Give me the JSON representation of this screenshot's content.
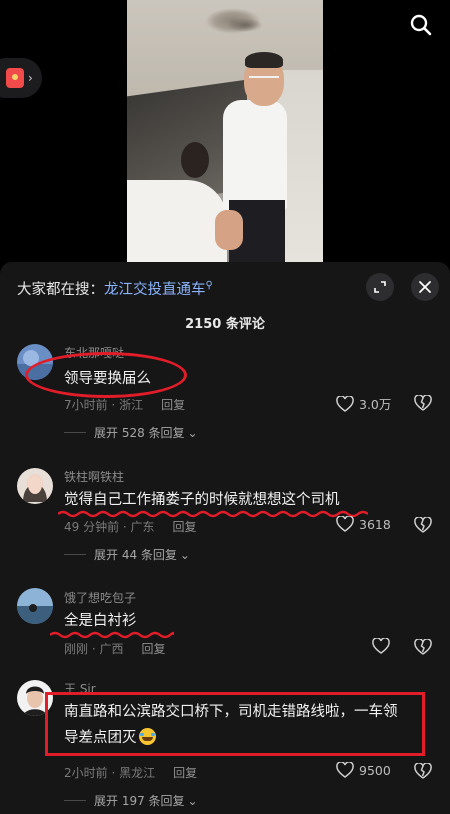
{
  "colors": {
    "panel_bg": "#161616",
    "annotation_red": "#e11d2a",
    "link_blue": "#8ab4ff"
  },
  "top": {
    "search_icon": "search-icon",
    "side_icon": "red-packet-icon"
  },
  "panel": {
    "hot_search_prefix": "大家都在搜：",
    "hot_search_term": "龙江交投直通车",
    "comment_count_title": "2150 条评论"
  },
  "comments": [
    {
      "username": "东北那嘎哒",
      "text": "领导要换届么",
      "time_location": "7小时前 · 浙江",
      "reply_label": "回复",
      "likes": "3.0万",
      "expand_label": "展开 528 条回复"
    },
    {
      "username": "铁柱啊铁柱",
      "text": "觉得自己工作捅娄子的时候就想想这个司机",
      "time_location": "49 分钟前 · 广东",
      "reply_label": "回复",
      "likes": "3618",
      "expand_label": "展开 44 条回复"
    },
    {
      "username": "饿了想吃包子",
      "text": "全是白衬衫",
      "time_location": "刚刚 · 广西",
      "reply_label": "回复",
      "likes": ""
    },
    {
      "username": "王 Sir",
      "text_line1": "南直路和公滨路交口桥下，司机走错路线啦，一车领",
      "text_line2": "导差点团灭",
      "time_location": "2小时前 · 黑龙江",
      "reply_label": "回复",
      "likes": "9500",
      "expand_label": "展开 197 条回复"
    }
  ]
}
